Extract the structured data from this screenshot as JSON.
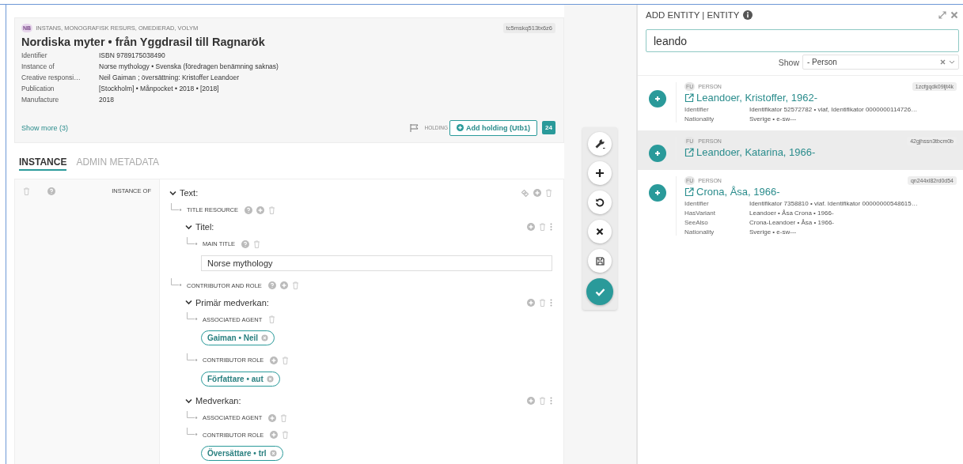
{
  "record": {
    "type_badge": "NB",
    "type": "INSTANS, MONOGRAFISK RESURS, OMEDIERAD, VOLYM",
    "id": "tc5mskq513tx6z6",
    "title": "Nordiska myter • från Yggdrasil till Ragnarök",
    "properties": [
      {
        "label": "Identifier",
        "value": "ISBN 9789175038490"
      },
      {
        "label": "Instance of",
        "value": "Norse mythology • Svenska (föredragen benämning saknas)"
      },
      {
        "label": "Creative responsi…",
        "value": "Neil Gaiman ; översättning: Kristoffer Leandoer"
      },
      {
        "label": "Publication",
        "value": "[Stockholm] • Månpocket • 2018 • [2018]"
      },
      {
        "label": "Manufacture",
        "value": "2018"
      }
    ],
    "show_more": "Show more (3)",
    "holding_label": "HOLDING",
    "add_holding": "Add holding (Utb1)",
    "holding_count": "24"
  },
  "tabs": [
    {
      "label": "INSTANCE",
      "selected": true
    },
    {
      "label": "ADMIN METADATA",
      "selected": false
    }
  ],
  "editor": {
    "property_label": "INSTANCE OF",
    "root": {
      "kind": "entity",
      "label": "Text:",
      "expanded": true,
      "children": [
        {
          "kind": "property",
          "label": "TITLE RESOURCE",
          "help": true,
          "add": true,
          "children": [
            {
              "kind": "entity",
              "label": "Titel:",
              "expanded": true,
              "children": [
                {
                  "kind": "property",
                  "label": "MAIN TITLE",
                  "help": true,
                  "add": false,
                  "children": [
                    {
                      "kind": "field",
                      "value": "Norse mythology"
                    }
                  ]
                }
              ]
            }
          ]
        },
        {
          "kind": "property",
          "label": "CONTRIBUTOR AND ROLE",
          "help": true,
          "add": true,
          "children": [
            {
              "kind": "entity",
              "label": "Primär medverkan:",
              "expanded": true,
              "children": [
                {
                  "kind": "property",
                  "label": "ASSOCIATED AGENT",
                  "help": false,
                  "add": false,
                  "children": [
                    {
                      "kind": "link",
                      "label": "Gaiman • Neil"
                    }
                  ]
                },
                {
                  "kind": "property",
                  "label": "CONTRIBUTOR ROLE",
                  "help": false,
                  "add": true,
                  "children": [
                    {
                      "kind": "link",
                      "label": "Författare • aut"
                    }
                  ]
                }
              ]
            },
            {
              "kind": "entity",
              "label": "Medverkan:",
              "expanded": true,
              "children": [
                {
                  "kind": "property",
                  "label": "ASSOCIATED AGENT",
                  "help": false,
                  "add": true
                },
                {
                  "kind": "property",
                  "label": "CONTRIBUTOR ROLE",
                  "help": false,
                  "add": true,
                  "children": [
                    {
                      "kind": "link",
                      "label": "Översättare • trl"
                    }
                  ]
                }
              ]
            }
          ]
        }
      ]
    }
  },
  "toolbar": [
    {
      "kind": "tools"
    },
    {
      "kind": "add"
    },
    {
      "kind": "undo"
    },
    {
      "kind": "cancel"
    },
    {
      "kind": "save"
    },
    {
      "kind": "done"
    }
  ],
  "panel": {
    "title": "ADD ENTITY | ENTITY",
    "search_value": "leando",
    "show_label": "Show",
    "show_value": "- Person",
    "results": [
      {
        "type_badge": "FU",
        "type": "PERSON",
        "id": "1zcfgqdk09ljt4k",
        "name": "Leandoer, Kristoffer, 1962-",
        "hovered": false,
        "properties": [
          {
            "label": "Identifier",
            "value": "Identifikator 52572782 • viaf, Identifikator 0000000114726…"
          },
          {
            "label": "Nationality",
            "value": "Sverige • e-sw---"
          }
        ]
      },
      {
        "type_badge": "FU",
        "type": "PERSON",
        "id": "42gjhssn3tbcm0b",
        "name": "Leandoer, Katarina, 1966-",
        "hovered": true
      },
      {
        "type_badge": "FU",
        "type": "PERSON",
        "id": "qn244xl82rd0d54",
        "name": "Crona, Åsa, 1966-",
        "hovered": false,
        "properties": [
          {
            "label": "Identifier",
            "value": "Identifikator 7358810 • viaf. Identifikator 00000000548615…"
          },
          {
            "label": "HasVariant",
            "value": "Leandoer • Åsa Crona • 1966-"
          },
          {
            "label": "SeeAlso",
            "value": "Crona-Leandoer • Åsa • 1966-"
          },
          {
            "label": "Nationality",
            "value": "Sverige • e-sw---"
          }
        ]
      }
    ]
  }
}
